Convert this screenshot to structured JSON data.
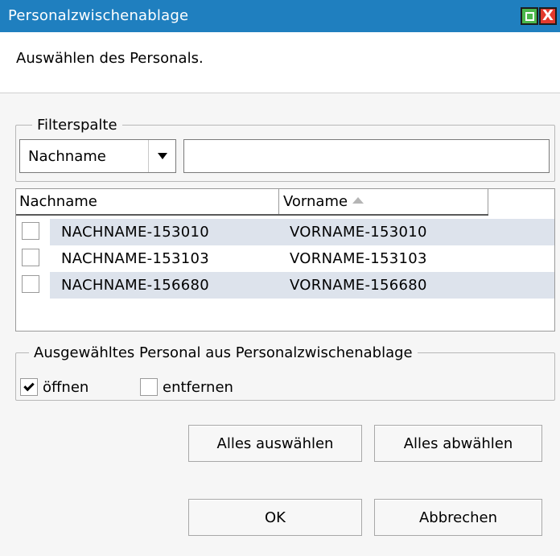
{
  "window": {
    "title": "Personalzwischenablage",
    "maximize_icon": "maximize-icon",
    "close_icon": "close-icon",
    "close_glyph": "X",
    "titlebar_color": "#1f7fbf"
  },
  "instruction": "Auswählen des Personals.",
  "filter": {
    "legend": "Filterspalte",
    "column_select_value": "Nachname",
    "text_value": ""
  },
  "grid": {
    "columns": [
      "Nachname",
      "Vorname"
    ],
    "sorted_column": "Vorname",
    "sort_direction": "ascending",
    "rows": [
      {
        "nachname": "NACHNAME-153010",
        "vorname": "VORNAME-153010",
        "checked": false
      },
      {
        "nachname": "NACHNAME-153103",
        "vorname": "VORNAME-153103",
        "checked": false
      },
      {
        "nachname": "NACHNAME-156680",
        "vorname": "VORNAME-156680",
        "checked": false
      }
    ],
    "alt_row_color": "#dde3ec"
  },
  "action": {
    "legend": "Ausgewähltes Personal aus Personalzwischenablage",
    "open_label": "öffnen",
    "open_checked": true,
    "remove_label": "entfernen",
    "remove_checked": false
  },
  "buttons": {
    "select_all": "Alles auswählen",
    "deselect_all": "Alles abwählen",
    "ok": "OK",
    "cancel": "Abbrechen"
  }
}
